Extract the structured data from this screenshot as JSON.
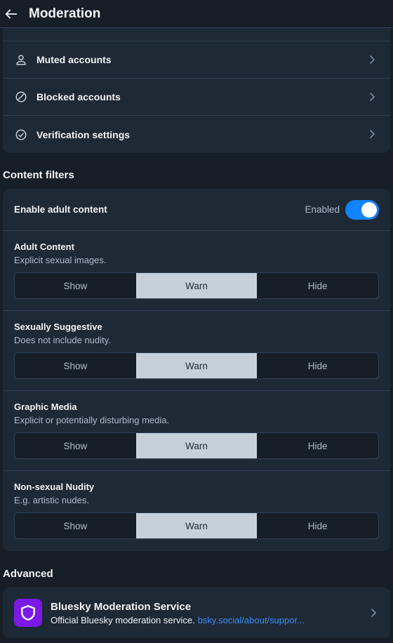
{
  "header": {
    "title": "Moderation"
  },
  "account_rows": [
    {
      "label": "Muted accounts",
      "icon": "person-icon"
    },
    {
      "label": "Blocked accounts",
      "icon": "block-icon"
    },
    {
      "label": "Verification settings",
      "icon": "check-circle-icon"
    }
  ],
  "content_filters": {
    "section_title": "Content filters",
    "adult_toggle": {
      "label": "Enable adult content",
      "status": "Enabled",
      "on": true
    },
    "filters": [
      {
        "title": "Adult Content",
        "description": "Explicit sexual images.",
        "options": [
          "Show",
          "Warn",
          "Hide"
        ],
        "selected": "Warn"
      },
      {
        "title": "Sexually Suggestive",
        "description": "Does not include nudity.",
        "options": [
          "Show",
          "Warn",
          "Hide"
        ],
        "selected": "Warn"
      },
      {
        "title": "Graphic Media",
        "description": "Explicit or potentially disturbing media.",
        "options": [
          "Show",
          "Warn",
          "Hide"
        ],
        "selected": "Warn"
      },
      {
        "title": "Non-sexual Nudity",
        "description": "E.g. artistic nudes.",
        "options": [
          "Show",
          "Warn",
          "Hide"
        ],
        "selected": "Warn"
      }
    ]
  },
  "advanced": {
    "section_title": "Advanced",
    "service": {
      "name": "Bluesky Moderation Service",
      "description": "Official Bluesky moderation service.",
      "link": "bsky.social/about/suppor..."
    }
  },
  "colors": {
    "accent": "#1083fe",
    "link": "#3b8ef5",
    "service_avatar": "#7b19e6",
    "selected_segment": "#c5d0da"
  }
}
